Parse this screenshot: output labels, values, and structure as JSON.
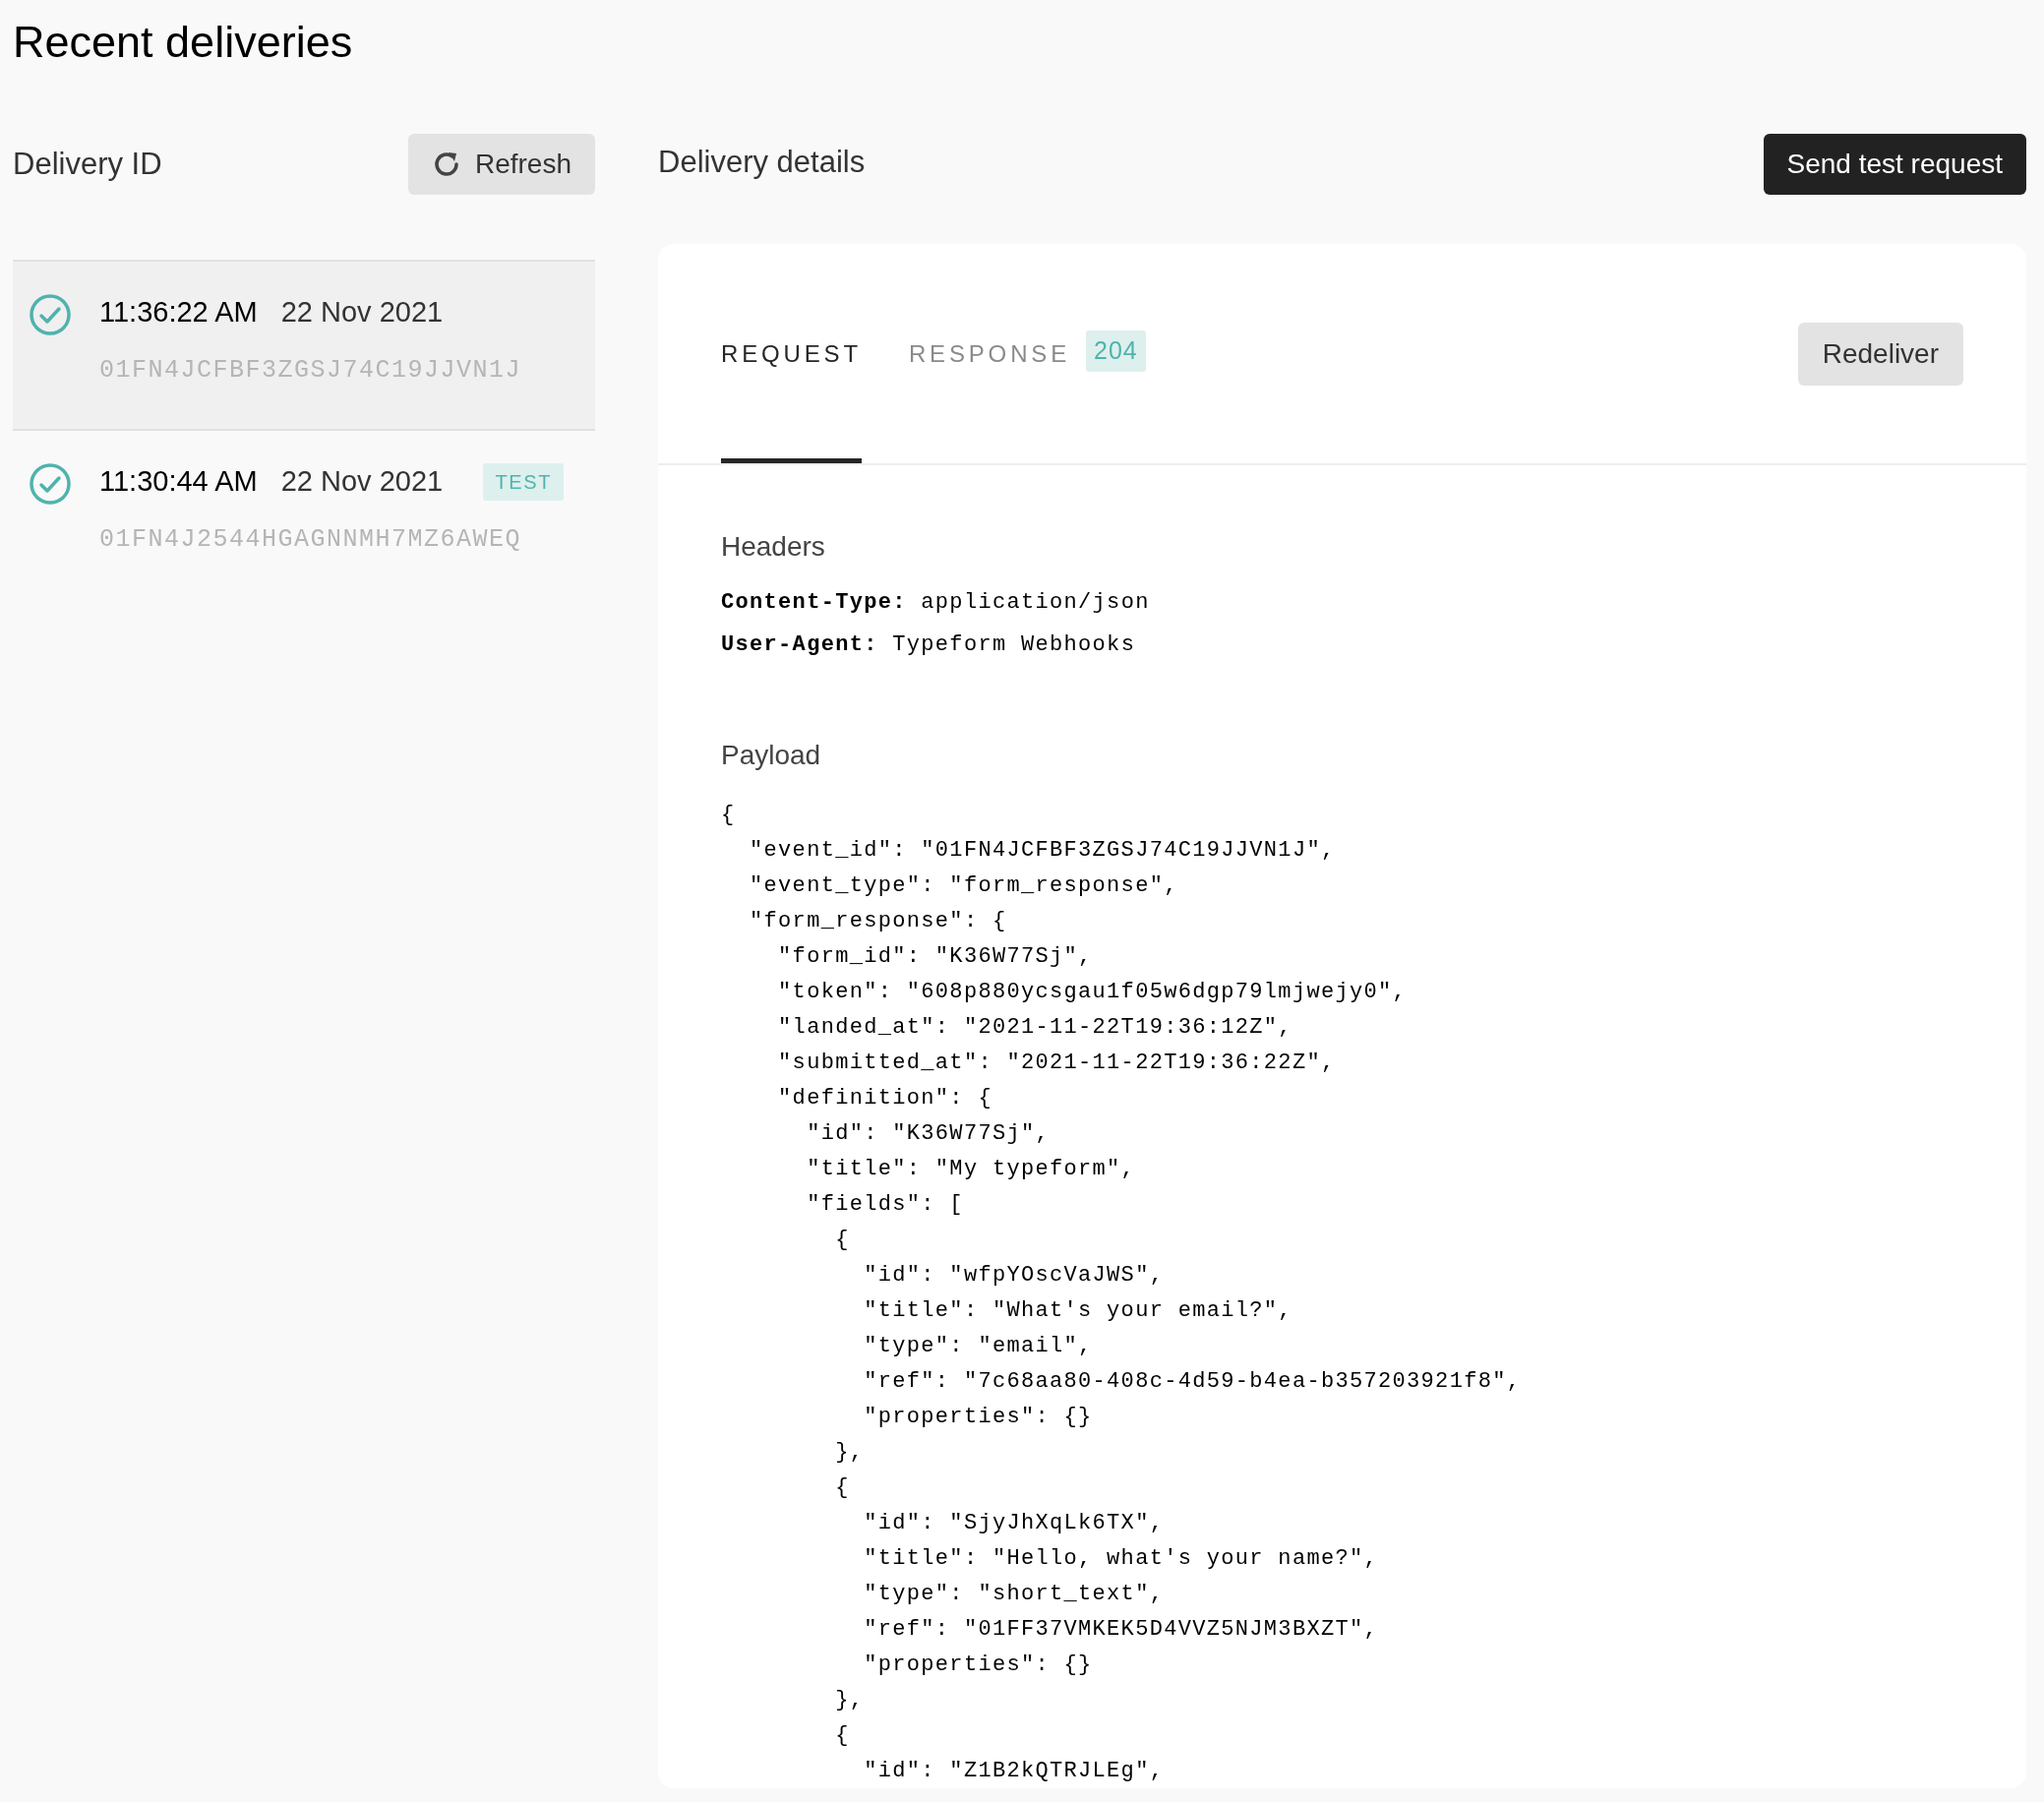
{
  "page_title": "Recent deliveries",
  "list_header": {
    "title": "Delivery ID",
    "refresh_button": "Refresh"
  },
  "deliveries": [
    {
      "time": "11:36:22 AM",
      "date": "22 Nov 2021",
      "id": "01FN4JCFBF3ZGSJ74C19JJVN1J",
      "succeeded": true,
      "selected": true
    },
    {
      "time": "11:30:44 AM",
      "date": "22 Nov 2021",
      "id": "01FN4J2544HGAGNNMH7MZ6AWEQ",
      "succeeded": true,
      "selected": false,
      "badge": "TEST"
    }
  ],
  "details_header": {
    "title": "Delivery details",
    "send_button": "Send test request"
  },
  "tabs": [
    {
      "label": "REQUEST",
      "selected": true
    },
    {
      "label": "RESPONSE",
      "selected": false,
      "badge": "204"
    }
  ],
  "redeliver_button": "Redeliver",
  "headers_section": {
    "title": "Headers",
    "rows": [
      {
        "key": "Content-Type:",
        "value": "application/json"
      },
      {
        "key": "User-Agent:",
        "value": "Typeform Webhooks"
      }
    ]
  },
  "payload_section": {
    "title": "Payload",
    "lines": [
      "{",
      "  \"event_id\": \"01FN4JCFBF3ZGSJ74C19JJVN1J\",",
      "  \"event_type\": \"form_response\",",
      "  \"form_response\": {",
      "    \"form_id\": \"K36W77Sj\",",
      "    \"token\": \"608p880ycsgau1f05w6dgp79lmjwejy0\",",
      "    \"landed_at\": \"2021-11-22T19:36:12Z\",",
      "    \"submitted_at\": \"2021-11-22T19:36:22Z\",",
      "    \"definition\": {",
      "      \"id\": \"K36W77Sj\",",
      "      \"title\": \"My typeform\",",
      "      \"fields\": [",
      "        {",
      "          \"id\": \"wfpYOscVaJWS\",",
      "          \"title\": \"What's your email?\",",
      "          \"type\": \"email\",",
      "          \"ref\": \"7c68aa80-408c-4d59-b4ea-b357203921f8\",",
      "          \"properties\": {}",
      "        },",
      "        {",
      "          \"id\": \"SjyJhXqLk6TX\",",
      "          \"title\": \"Hello, what's your name?\",",
      "          \"type\": \"short_text\",",
      "          \"ref\": \"01FF37VMKEK5D4VVZ5NJM3BXZT\",",
      "          \"properties\": {}",
      "        },",
      "        {",
      "          \"id\": \"Z1B2kQTRJLEg\","
    ]
  }
}
